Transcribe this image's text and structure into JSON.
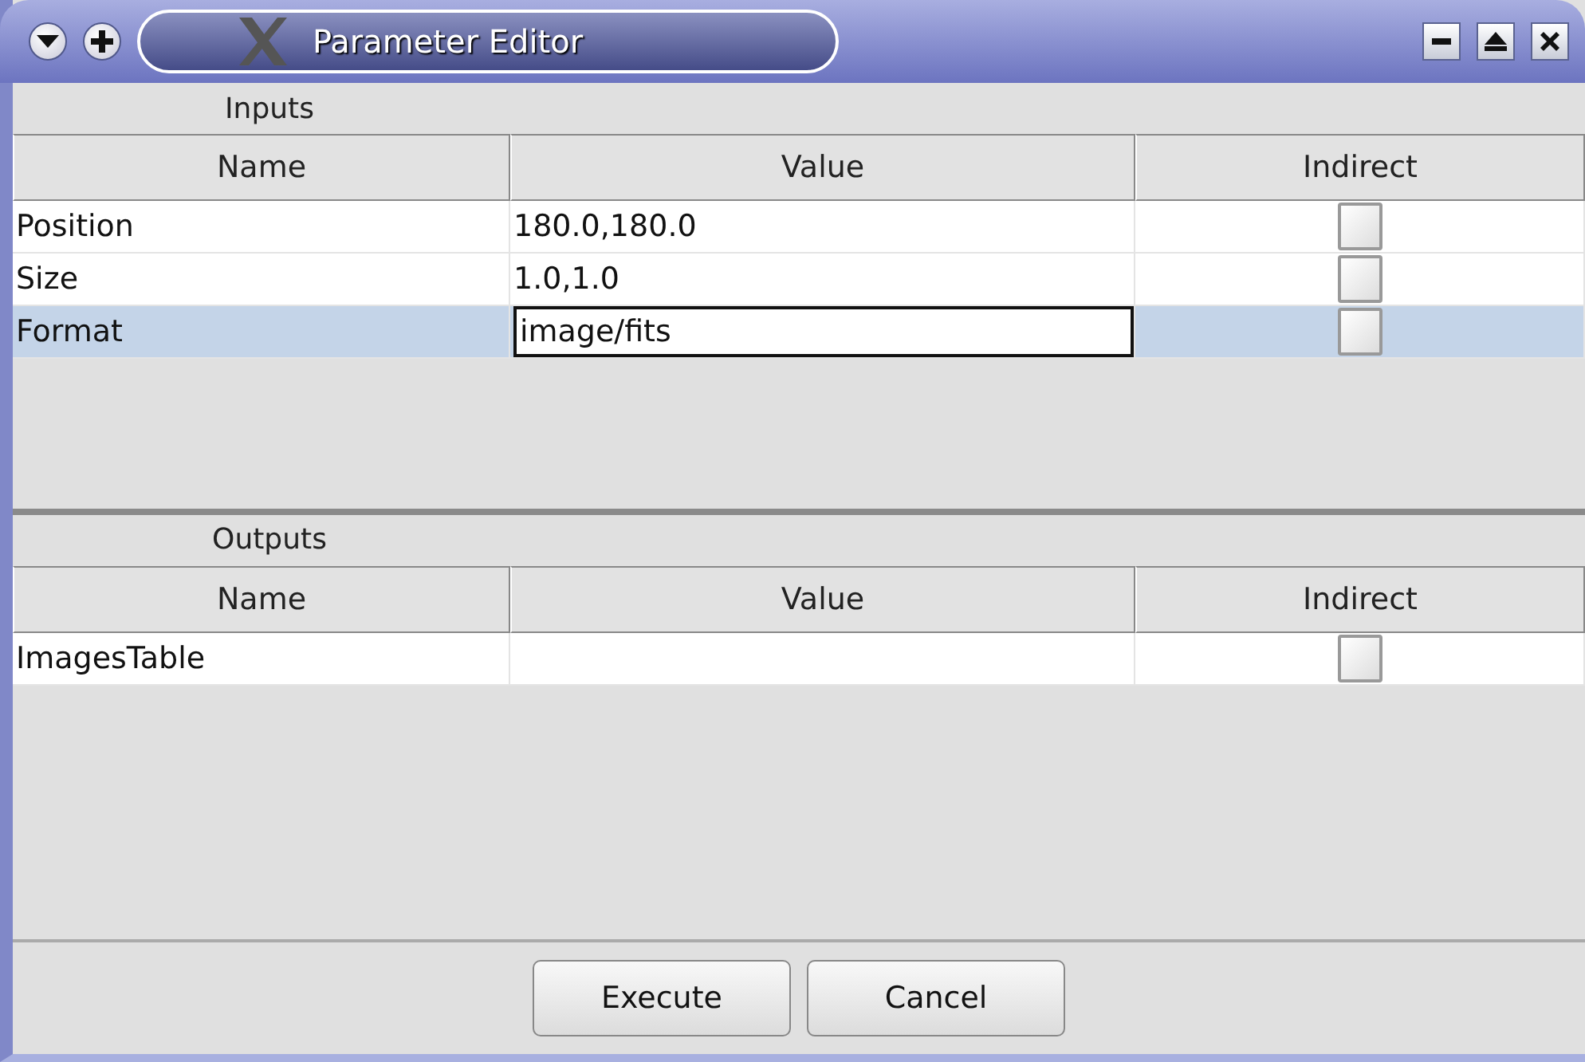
{
  "window": {
    "title": "Parameter Editor"
  },
  "sections": [
    {
      "label": "Inputs",
      "columns": [
        "Name",
        "Value",
        "Indirect"
      ],
      "rows": [
        {
          "name": "Position",
          "value": "180.0,180.0",
          "indirect": false,
          "selected": false,
          "editing": false
        },
        {
          "name": "Size",
          "value": "1.0,1.0",
          "indirect": false,
          "selected": false,
          "editing": false
        },
        {
          "name": "Format",
          "value": "image/fits",
          "indirect": false,
          "selected": true,
          "editing": true
        }
      ]
    },
    {
      "label": "Outputs",
      "columns": [
        "Name",
        "Value",
        "Indirect"
      ],
      "rows": [
        {
          "name": "ImagesTable",
          "value": "",
          "indirect": false,
          "selected": false,
          "editing": false
        }
      ]
    }
  ],
  "buttons": [
    "Execute",
    "Cancel"
  ]
}
